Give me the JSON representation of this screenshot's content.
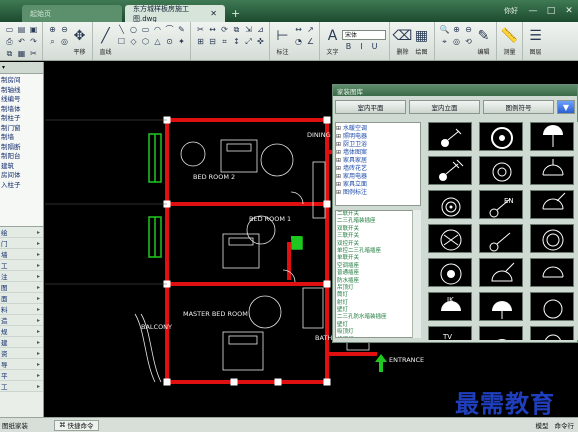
{
  "titlebar": {
    "tab1": "起始页",
    "tab2": "东方城样板房施工图.dwg",
    "new_tab": "+",
    "user": "你好",
    "win_min": "—",
    "win_max": "□",
    "win_close": "✕"
  },
  "ribbon": {
    "pan_label": "平移",
    "line_label": "直线",
    "wall_label": "标注",
    "text_label": "文字",
    "font_value": "宋体",
    "match_label": "删除",
    "layer_label": "图层",
    "measure_label": "测量",
    "label_a": "绘图",
    "label_b": "编辑",
    "icons_draw": [
      "╲",
      "○",
      "▭",
      "◠",
      "⌒",
      "✎",
      "☐",
      "◇",
      "⬡",
      "△",
      "⊙",
      "✦"
    ],
    "icons_edit": [
      "✂",
      "↔",
      "⟳",
      "⧉",
      "⇲",
      "⊿",
      "⊞",
      "⊟",
      "⌗",
      "↕",
      "⤢",
      "✜"
    ],
    "icons_view": [
      "🔍",
      "⊕",
      "⊖",
      "⌖",
      "◎",
      "⟲"
    ]
  },
  "left_panel": {
    "header": "▾",
    "items": [
      "制房间",
      "制轴线",
      "线编号",
      "制墙体",
      "制柱子",
      "制门窗",
      "制墙",
      "制隔断",
      "制阳台",
      "建筑",
      "房间体",
      "入柱子"
    ],
    "rows": [
      "绘",
      "门",
      "墙",
      "工",
      "注",
      "图",
      "面",
      "料",
      "造",
      "规",
      "建",
      "资",
      "导",
      "平",
      "工"
    ]
  },
  "canvas": {
    "room_labels": [
      "BED ROOM 2",
      "BED ROOM 1",
      "MASTER BED ROOM",
      "BALCONY",
      "DINING",
      "ENTRANCE",
      "BATH"
    ]
  },
  "library": {
    "title": "家装图库",
    "tabs": [
      "室内平面",
      "室内立面",
      "图例符号"
    ],
    "tab_arrow": "▼",
    "tree": [
      "水暖空调",
      "照明电器",
      "厨卫卫浴",
      "墙体图案",
      "家具家居",
      "墙砖花艺",
      "家用电器",
      "家具立面",
      "图例标注"
    ],
    "list": [
      "二联开关",
      "二三孔暗装插座",
      "双联开关",
      "三联开关",
      "双控开关",
      "单控二三孔暗插座",
      "单联开关",
      "空调插座",
      "普通插座",
      "防水插座",
      "吊顶灯",
      "筒灯",
      "射灯",
      "壁灯",
      "二三孔防水暗装插座",
      "壁灯",
      "吸顶灯",
      "格栅灯",
      "暗装插座",
      "吊扇",
      "暗装单相插座",
      "电话",
      "电视",
      "网络插座",
      "宽带插座",
      "开关",
      "插座",
      "烟感",
      "安全出口"
    ],
    "thumb_texts": [
      "EN",
      "IK",
      "TV"
    ]
  },
  "statusbar": {
    "left": "图纸家装",
    "cmd": "快捷命令",
    "right1": "模型",
    "right2": "命令行"
  },
  "watermark": "最需教育"
}
